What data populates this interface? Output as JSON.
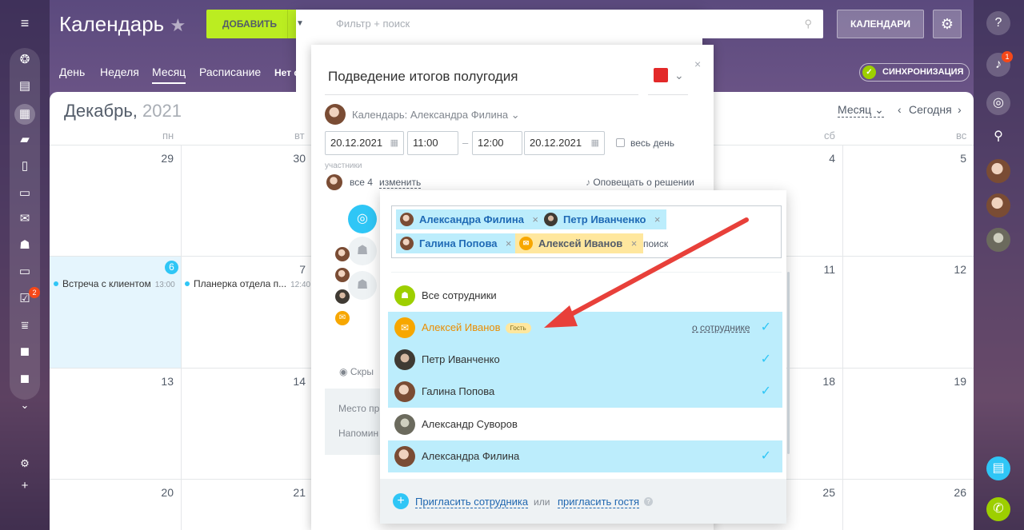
{
  "header": {
    "title": "Календарь",
    "add_label": "ДОБАВИТЬ",
    "search_placeholder": "Фильтр + поиск",
    "calendars_label": "КАЛЕНДАРИ",
    "sync_label": "СИНХРОНИЗАЦИЯ"
  },
  "views": [
    "День",
    "Неделя",
    "Месяц",
    "Расписание",
    "Нет соб"
  ],
  "month": {
    "name": "Декабрь,",
    "year": "2021",
    "mode": "Месяц",
    "today": "Сегодня"
  },
  "weekdays": [
    "пн",
    "вт",
    "сб",
    "вс"
  ],
  "days": {
    "r1": [
      "29",
      "30",
      "4",
      "5"
    ],
    "r2": [
      "6",
      "7",
      "11",
      "12"
    ],
    "r3": [
      "13",
      "14",
      "18",
      "19"
    ],
    "r4": [
      "20",
      "21",
      "25",
      "26"
    ]
  },
  "events": [
    {
      "title": "Встреча с клиентом",
      "time": "13:00"
    },
    {
      "title": "Планерка отдела п...",
      "time": "12:40"
    }
  ],
  "notif_count": "1",
  "tasks_count": "2",
  "popup": {
    "title": "Подведение итогов полугодия",
    "calendar": "Календарь: Александра Филина",
    "date_from": "20.12.2021",
    "time_from": "11:00",
    "dash": "–",
    "time_to": "12:00",
    "date_to": "20.12.2021",
    "all_day": "весь день",
    "participants_label": "участники",
    "all_count": "все 4",
    "change": "изменить",
    "notify": "Оповещать о решении",
    "hide": "Скры",
    "place": "Место пр",
    "reminder": "Напомин",
    "color": "#e32929"
  },
  "selector": {
    "tags": [
      {
        "name": "Александра Филина"
      },
      {
        "name": "Петр Иванченко"
      },
      {
        "name": "Галина Попова"
      },
      {
        "name": "Алексей Иванов"
      }
    ],
    "search_text": "поиск",
    "items": [
      {
        "name": "Все сотрудники"
      },
      {
        "name": "Алексей Иванов",
        "badge": "Гость",
        "link": "о сотруднике"
      },
      {
        "name": "Петр Иванченко"
      },
      {
        "name": "Галина Попова"
      },
      {
        "name": "Александр Суворов"
      },
      {
        "name": "Александра Филина"
      }
    ],
    "invite_employee": "Пригласить сотрудника",
    "or": "или",
    "invite_guest": "пригласить гостя"
  }
}
